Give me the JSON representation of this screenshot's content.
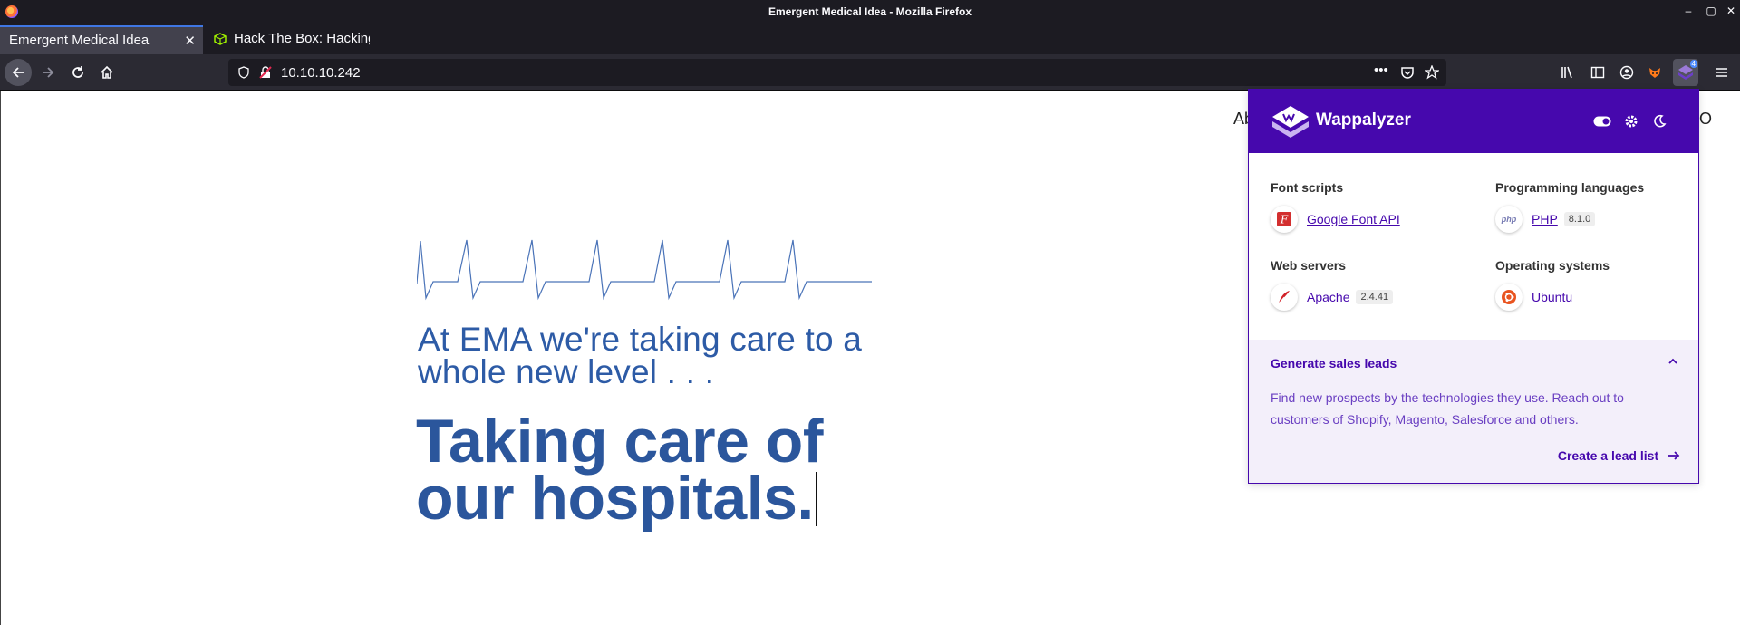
{
  "window": {
    "title": "Emergent Medical Idea - Mozilla Firefox",
    "controls": {
      "minimize": "–",
      "maximize": "▢",
      "close": "✕"
    }
  },
  "tabs": [
    {
      "label": "Emergent Medical Idea",
      "active": true,
      "close": "✕"
    },
    {
      "label": "Hack The Box: Hacking T",
      "active": false,
      "close": "✕"
    }
  ],
  "new_tab_label": "+",
  "navbar": {
    "url": "10.10.10.242",
    "page_actions": "•••",
    "extension_badge": "4"
  },
  "page": {
    "nav_left_peek": "Ab",
    "nav_right_peek": "SO",
    "tagline": "At EMA we're taking care to a whole new level . . .",
    "headline_line1": "Taking care of",
    "headline_line2": "our hospitals."
  },
  "wappalyzer": {
    "brand": "Wappalyzer",
    "categories": [
      {
        "title": "Font scripts",
        "tech": "Google Font API",
        "version": "",
        "icon": "google-font-api-icon"
      },
      {
        "title": "Programming languages",
        "tech": "PHP",
        "version": "8.1.0",
        "icon": "php-icon",
        "icon_text": "php"
      },
      {
        "title": "Web servers",
        "tech": "Apache",
        "version": "2.4.41",
        "icon": "apache-feather-icon"
      },
      {
        "title": "Operating systems",
        "tech": "Ubuntu",
        "version": "",
        "icon": "ubuntu-icon"
      }
    ],
    "leads": {
      "title": "Generate sales leads",
      "text": "Find new prospects by the technologies they use. Reach out to customers of Shopify, Magento, Salesforce and others.",
      "link": "Create a lead list"
    }
  },
  "colors": {
    "browser_chrome": "#1c1b22",
    "navbar": "#2b2a33",
    "tab_accent": "#3f77e4",
    "wappalyzer_purple": "#4608ad",
    "page_blue": "#2b569c"
  }
}
